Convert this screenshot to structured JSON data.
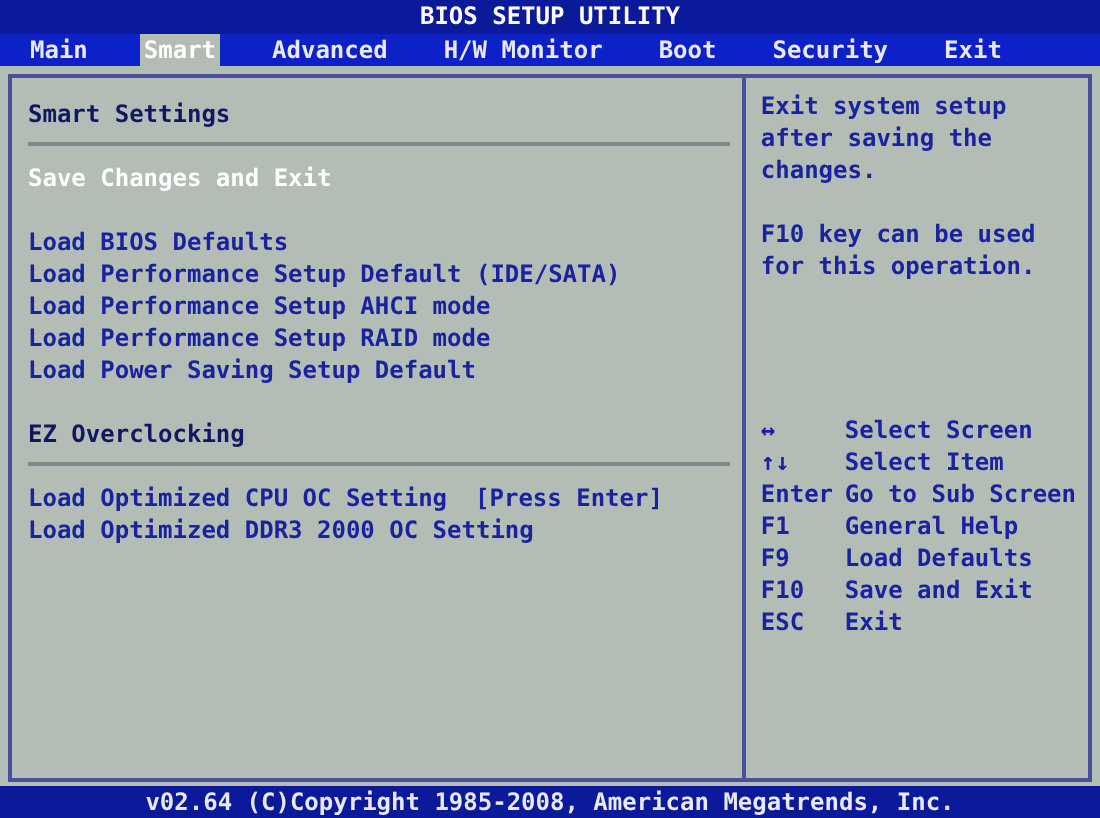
{
  "window": {
    "title": "BIOS SETUP UTILITY"
  },
  "tabs": [
    {
      "label": "Main",
      "selected": false
    },
    {
      "label": "Smart",
      "selected": true
    },
    {
      "label": "Advanced",
      "selected": false
    },
    {
      "label": "H/W Monitor",
      "selected": false
    },
    {
      "label": "Boot",
      "selected": false
    },
    {
      "label": "Security",
      "selected": false
    },
    {
      "label": "Exit",
      "selected": false
    }
  ],
  "sections": [
    {
      "title": "Smart Settings",
      "groups": [
        [
          {
            "label": "Save Changes and Exit",
            "selected": true
          }
        ],
        [
          {
            "label": "Load BIOS Defaults",
            "selected": false
          },
          {
            "label": "Load Performance Setup Default (IDE/SATA)",
            "selected": false
          },
          {
            "label": "Load Performance Setup AHCI mode",
            "selected": false
          },
          {
            "label": "Load Performance Setup RAID mode",
            "selected": false
          },
          {
            "label": "Load Power Saving Setup Default",
            "selected": false
          }
        ]
      ]
    },
    {
      "title": "EZ Overclocking",
      "groups": [
        [
          {
            "label": "Load Optimized CPU OC Setting",
            "value": "[Press Enter]",
            "selected": false
          },
          {
            "label": "Load Optimized DDR3 2000 OC Setting",
            "selected": false
          }
        ]
      ]
    }
  ],
  "help": [
    "Exit system setup after saving the changes.",
    "F10 key can be used for this operation."
  ],
  "keys": [
    {
      "key": "↔",
      "action": "Select Screen"
    },
    {
      "key": "↑↓",
      "action": "Select Item"
    },
    {
      "key": "Enter",
      "action": "Go to Sub Screen"
    },
    {
      "key": "F1",
      "action": "General Help"
    },
    {
      "key": "F9",
      "action": "Load Defaults"
    },
    {
      "key": "F10",
      "action": "Save and Exit"
    },
    {
      "key": "ESC",
      "action": "Exit"
    }
  ],
  "status_bar": "v02.64 (C)Copyright 1985-2008, American Megatrends, Inc."
}
